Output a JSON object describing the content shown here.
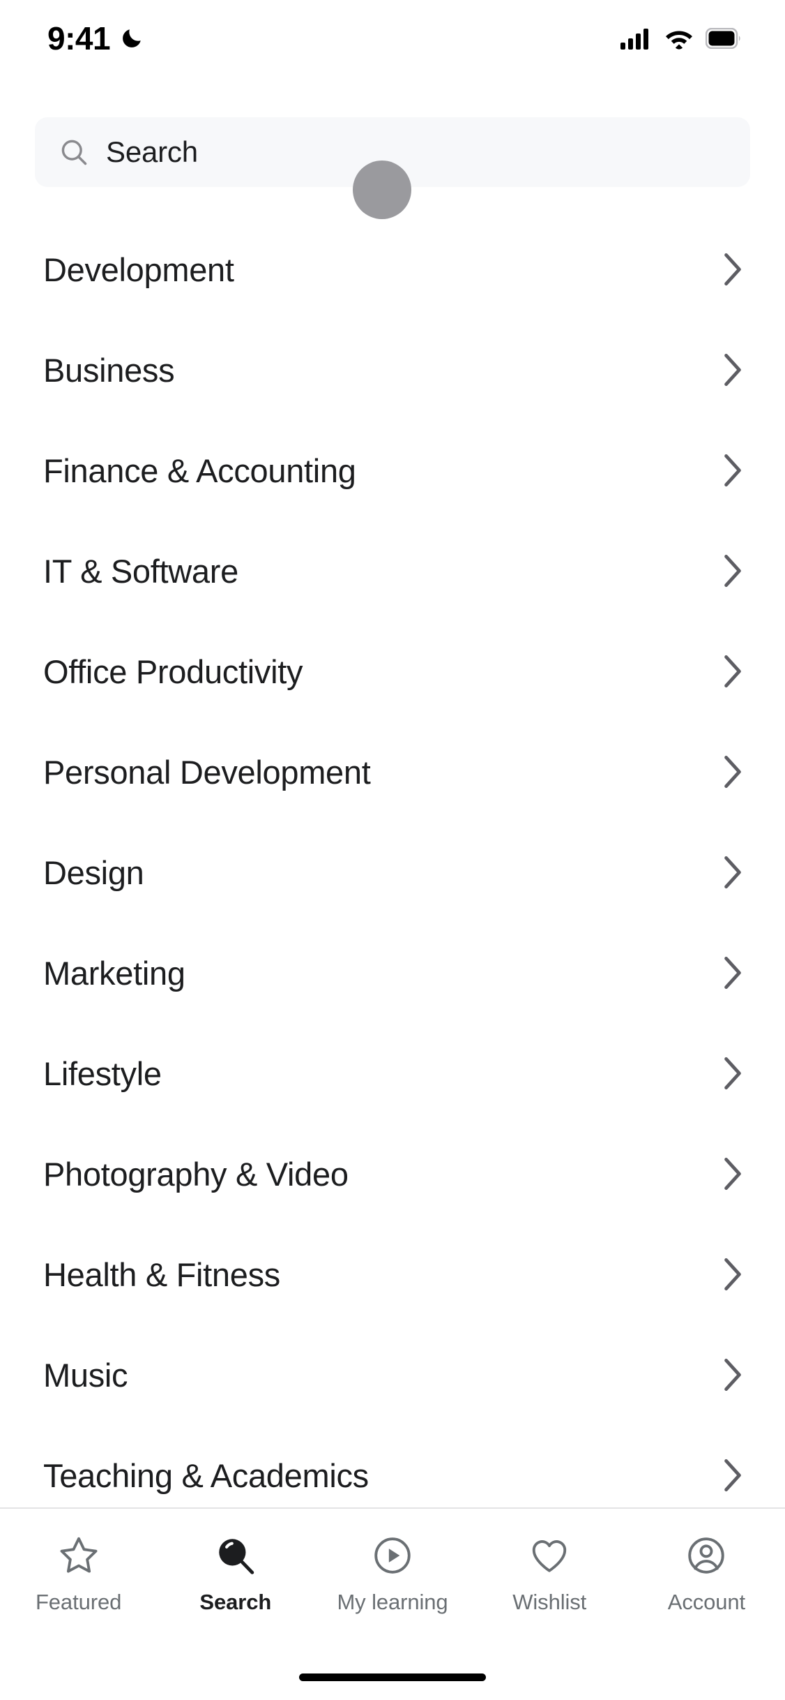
{
  "status_bar": {
    "time": "9:41",
    "dnd_icon": "moon-icon",
    "signal_icon": "cellular-signal-icon",
    "wifi_icon": "wifi-icon",
    "battery_icon": "battery-full-icon"
  },
  "search": {
    "icon": "search-icon",
    "placeholder": "Search",
    "value": ""
  },
  "touch_indicator": {
    "visible": true,
    "color": "#9a9a9e"
  },
  "categories": [
    {
      "label": "Development",
      "chevron": "chevron-right-icon"
    },
    {
      "label": "Business",
      "chevron": "chevron-right-icon"
    },
    {
      "label": "Finance & Accounting",
      "chevron": "chevron-right-icon"
    },
    {
      "label": "IT & Software",
      "chevron": "chevron-right-icon"
    },
    {
      "label": "Office Productivity",
      "chevron": "chevron-right-icon"
    },
    {
      "label": "Personal Development",
      "chevron": "chevron-right-icon"
    },
    {
      "label": "Design",
      "chevron": "chevron-right-icon"
    },
    {
      "label": "Marketing",
      "chevron": "chevron-right-icon"
    },
    {
      "label": "Lifestyle",
      "chevron": "chevron-right-icon"
    },
    {
      "label": "Photography & Video",
      "chevron": "chevron-right-icon"
    },
    {
      "label": "Health & Fitness",
      "chevron": "chevron-right-icon"
    },
    {
      "label": "Music",
      "chevron": "chevron-right-icon"
    },
    {
      "label": "Teaching & Academics",
      "chevron": "chevron-right-icon"
    }
  ],
  "tab_bar": {
    "active_index": 1,
    "items": [
      {
        "label": "Featured",
        "icon": "star-outline-icon"
      },
      {
        "label": "Search",
        "icon": "search-filled-icon"
      },
      {
        "label": "My learning",
        "icon": "play-circle-icon"
      },
      {
        "label": "Wishlist",
        "icon": "heart-outline-icon"
      },
      {
        "label": "Account",
        "icon": "person-circle-icon"
      }
    ]
  },
  "colors": {
    "text_primary": "#1c1d1f",
    "text_secondary": "#6a6f73",
    "search_bg": "#f7f8fa",
    "divider": "#e3e3e5",
    "chevron": "#5d5d63"
  }
}
